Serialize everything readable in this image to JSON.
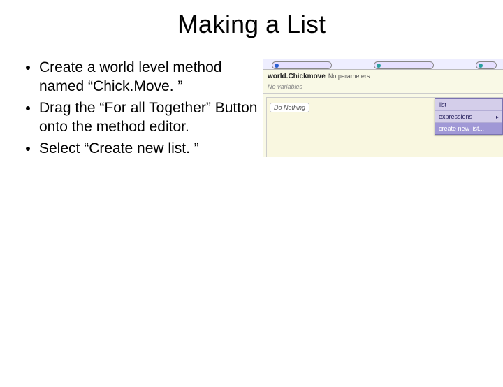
{
  "title": "Making a List",
  "bullets": [
    "Create a world level method named “Chick.Move. ”",
    "Drag the “For all Together” Button onto the method editor.",
    "Select “Create new list. ”"
  ],
  "screenshot": {
    "methodName": "world.Chickmove",
    "methodParams": "No parameters",
    "noVariables": "No variables",
    "doNothing": "Do Nothing",
    "menu": {
      "item1": "list",
      "item2": "expressions",
      "item3": "create new list..."
    }
  }
}
